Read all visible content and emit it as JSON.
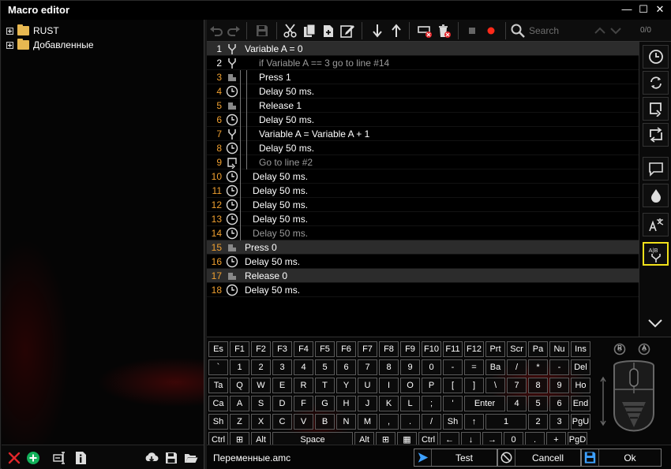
{
  "window": {
    "title": "Macro editor",
    "controls": {
      "minimize": "—",
      "maximize": "☐",
      "close": "✕"
    }
  },
  "tree": {
    "items": [
      {
        "label": "RUST",
        "icon": "folder-icon"
      },
      {
        "label": "Добавленные",
        "icon": "folder-icon"
      }
    ]
  },
  "toolbar": {
    "search_placeholder": "Search",
    "search_count": "0/0"
  },
  "macro": {
    "rows": [
      {
        "num": "1",
        "type": "branch",
        "text": "Variable A = 0",
        "indent": 0,
        "dim": false,
        "highlight": true,
        "num_color": "white"
      },
      {
        "num": "2",
        "type": "branch",
        "text": "if Variable A == 3 go to line #14",
        "indent": 2,
        "dim": true,
        "highlight": false,
        "num_color": "white"
      },
      {
        "num": "3",
        "type": "keypress",
        "text": "Press 1",
        "indent": 2,
        "dim": false,
        "highlight": false,
        "num_color": "orange"
      },
      {
        "num": "4",
        "type": "delay",
        "text": "Delay 50 ms.",
        "indent": 2,
        "dim": false,
        "highlight": false,
        "num_color": "orange"
      },
      {
        "num": "5",
        "type": "keypress",
        "text": "Release 1",
        "indent": 2,
        "dim": false,
        "highlight": false,
        "num_color": "orange"
      },
      {
        "num": "6",
        "type": "delay",
        "text": "Delay 50 ms.",
        "indent": 2,
        "dim": false,
        "highlight": false,
        "num_color": "orange"
      },
      {
        "num": "7",
        "type": "branch",
        "text": "Variable A = Variable A + 1",
        "indent": 2,
        "dim": false,
        "highlight": false,
        "num_color": "orange"
      },
      {
        "num": "8",
        "type": "delay",
        "text": "Delay 50 ms.",
        "indent": 2,
        "dim": false,
        "highlight": false,
        "num_color": "orange"
      },
      {
        "num": "9",
        "type": "goto",
        "text": "Go to line #2",
        "indent": 2,
        "dim": true,
        "highlight": false,
        "num_color": "orange"
      },
      {
        "num": "10",
        "type": "delay",
        "text": "Delay 50 ms.",
        "indent": 1,
        "dim": false,
        "highlight": false,
        "num_color": "orange"
      },
      {
        "num": "11",
        "type": "delay",
        "text": "Delay 50 ms.",
        "indent": 1,
        "dim": false,
        "highlight": false,
        "num_color": "orange"
      },
      {
        "num": "12",
        "type": "delay",
        "text": "Delay 50 ms.",
        "indent": 1,
        "dim": false,
        "highlight": false,
        "num_color": "orange"
      },
      {
        "num": "13",
        "type": "delay",
        "text": "Delay 50 ms.",
        "indent": 1,
        "dim": false,
        "highlight": false,
        "num_color": "orange"
      },
      {
        "num": "14",
        "type": "delay",
        "text": "Delay 50 ms.",
        "indent": 1,
        "dim": true,
        "highlight": false,
        "num_color": "orange"
      },
      {
        "num": "15",
        "type": "keypress",
        "text": "Press 0",
        "indent": 0,
        "dim": false,
        "highlight": true,
        "num_color": "orange"
      },
      {
        "num": "16",
        "type": "delay",
        "text": "Delay 50 ms.",
        "indent": 0,
        "dim": false,
        "highlight": false,
        "num_color": "orange"
      },
      {
        "num": "17",
        "type": "keypress",
        "text": "Release 0",
        "indent": 0,
        "dim": false,
        "highlight": true,
        "num_color": "orange"
      },
      {
        "num": "18",
        "type": "delay",
        "text": "Delay 50 ms.",
        "indent": 0,
        "dim": false,
        "highlight": false,
        "num_color": "orange"
      }
    ]
  },
  "sidebar": {
    "buttons": [
      {
        "name": "add-delay-icon"
      },
      {
        "name": "repeat-icon"
      },
      {
        "name": "goto-icon"
      },
      {
        "name": "loop-icon"
      },
      {
        "name": "comment-icon"
      },
      {
        "name": "drop-icon"
      },
      {
        "name": "translate-icon"
      },
      {
        "name": "variable-branch-icon",
        "active": true
      }
    ]
  },
  "keyboard": {
    "rows": [
      [
        "Es",
        "F1",
        "F2",
        "F3",
        "F4",
        "F5",
        "F6",
        "F7",
        "F8",
        "F9",
        "F10",
        "F11",
        "F12",
        "Prt",
        "Scr",
        "Pa",
        "Nu",
        "Ins"
      ],
      [
        "`",
        "1",
        "2",
        "3",
        "4",
        "5",
        "6",
        "7",
        "8",
        "9",
        "0",
        "-",
        "=",
        "Ba",
        "/",
        "*",
        "-",
        "Del"
      ],
      [
        "Ta",
        "Q",
        "W",
        "E",
        "R",
        "T",
        "Y",
        "U",
        "I",
        "O",
        "P",
        "[",
        "]",
        "\\",
        "7",
        "8",
        "9",
        "Ho"
      ],
      [
        "Ca",
        "A",
        "S",
        "D",
        "F",
        "G",
        "H",
        "J",
        "K",
        "L",
        ";",
        "'",
        "Enter",
        "4",
        "5",
        "6",
        "End"
      ],
      [
        "Sh",
        "Z",
        "X",
        "C",
        "V",
        "B",
        "N",
        "M",
        ",",
        ".",
        "/",
        "Sh",
        "↑",
        "1",
        "2",
        "3",
        "PgU"
      ],
      [
        "Ctrl",
        "⊞",
        "Alt",
        "Space",
        "Alt",
        "⊞",
        "▦",
        "Ctrl",
        "←",
        "↓",
        "→",
        "0",
        ".",
        "+",
        "PgD"
      ]
    ],
    "mouse_labels": {
      "left": "R",
      "right": "A"
    }
  },
  "bottom": {
    "filename": "Переменные.amc",
    "test_label": "Test",
    "cancel_label": "Cancell",
    "ok_label": "Ok"
  },
  "colors": {
    "accent_yellow": "#f2e01a",
    "row_num_orange": "#f0a030",
    "record_red": "#ff2a1a",
    "add_green": "#12b05a"
  }
}
